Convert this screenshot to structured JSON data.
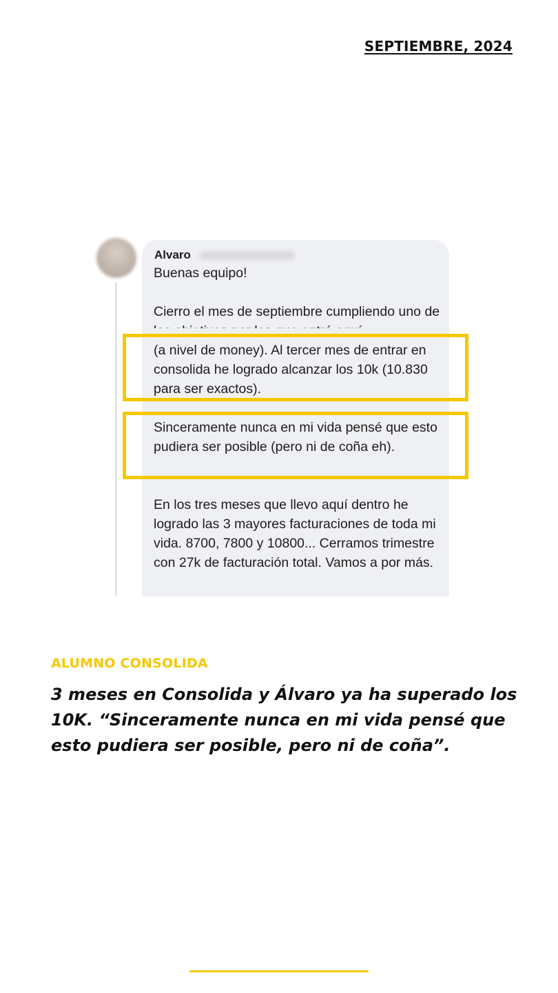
{
  "header": {
    "date": "SEPTIEMBRE, 2024"
  },
  "post": {
    "author": "Alvaro",
    "greeting": "Buenas equipo!",
    "paragraph1": "Cierro el mes de septiembre cumpliendo uno de los objetivos por los que entré aquí",
    "paragraph1_highlight": "(a nivel de money). Al tercer mes de entrar en consolida he logrado alcanzar los 10k (10.830 para ser exactos).",
    "paragraph2": "Sinceramente nunca en mi vida pensé que esto pudiera ser posible (pero ni de coña eh).",
    "paragraph3": "En los tres meses que llevo aquí dentro he logrado las 3 mayores facturaciones de toda mi vida. 8700, 7800 y 10800... Cerramos trimestre con 27k de facturación total. Vamos a por más.",
    "highlight_color": "#f6c800"
  },
  "caption": {
    "tag": "ALUMNO CONSOLIDA",
    "headline": "3 meses en Consolida y Álvaro ya ha superado los 10K. “Sinceramente nunca en mi vida pensé que esto pudiera ser posible, pero ni de coña”."
  },
  "colors": {
    "accent": "#f6c800",
    "bubble": "#eff0f3"
  }
}
